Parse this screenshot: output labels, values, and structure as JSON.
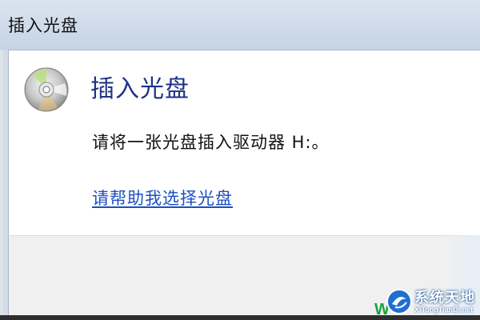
{
  "window": {
    "title": "插入光盘"
  },
  "dialog": {
    "icon": "cd-disc-icon",
    "heading": "插入光盘",
    "message": "请将一张光盘插入驱动器 H:。",
    "help_link": "请帮助我选择光盘"
  },
  "watermark": {
    "letter": "W",
    "title": "系统天地",
    "url": "XiTongTianDi.net"
  },
  "colors": {
    "heading": "#1e3287",
    "link": "#1a4fbf",
    "titlebar": "#d3deeb"
  }
}
